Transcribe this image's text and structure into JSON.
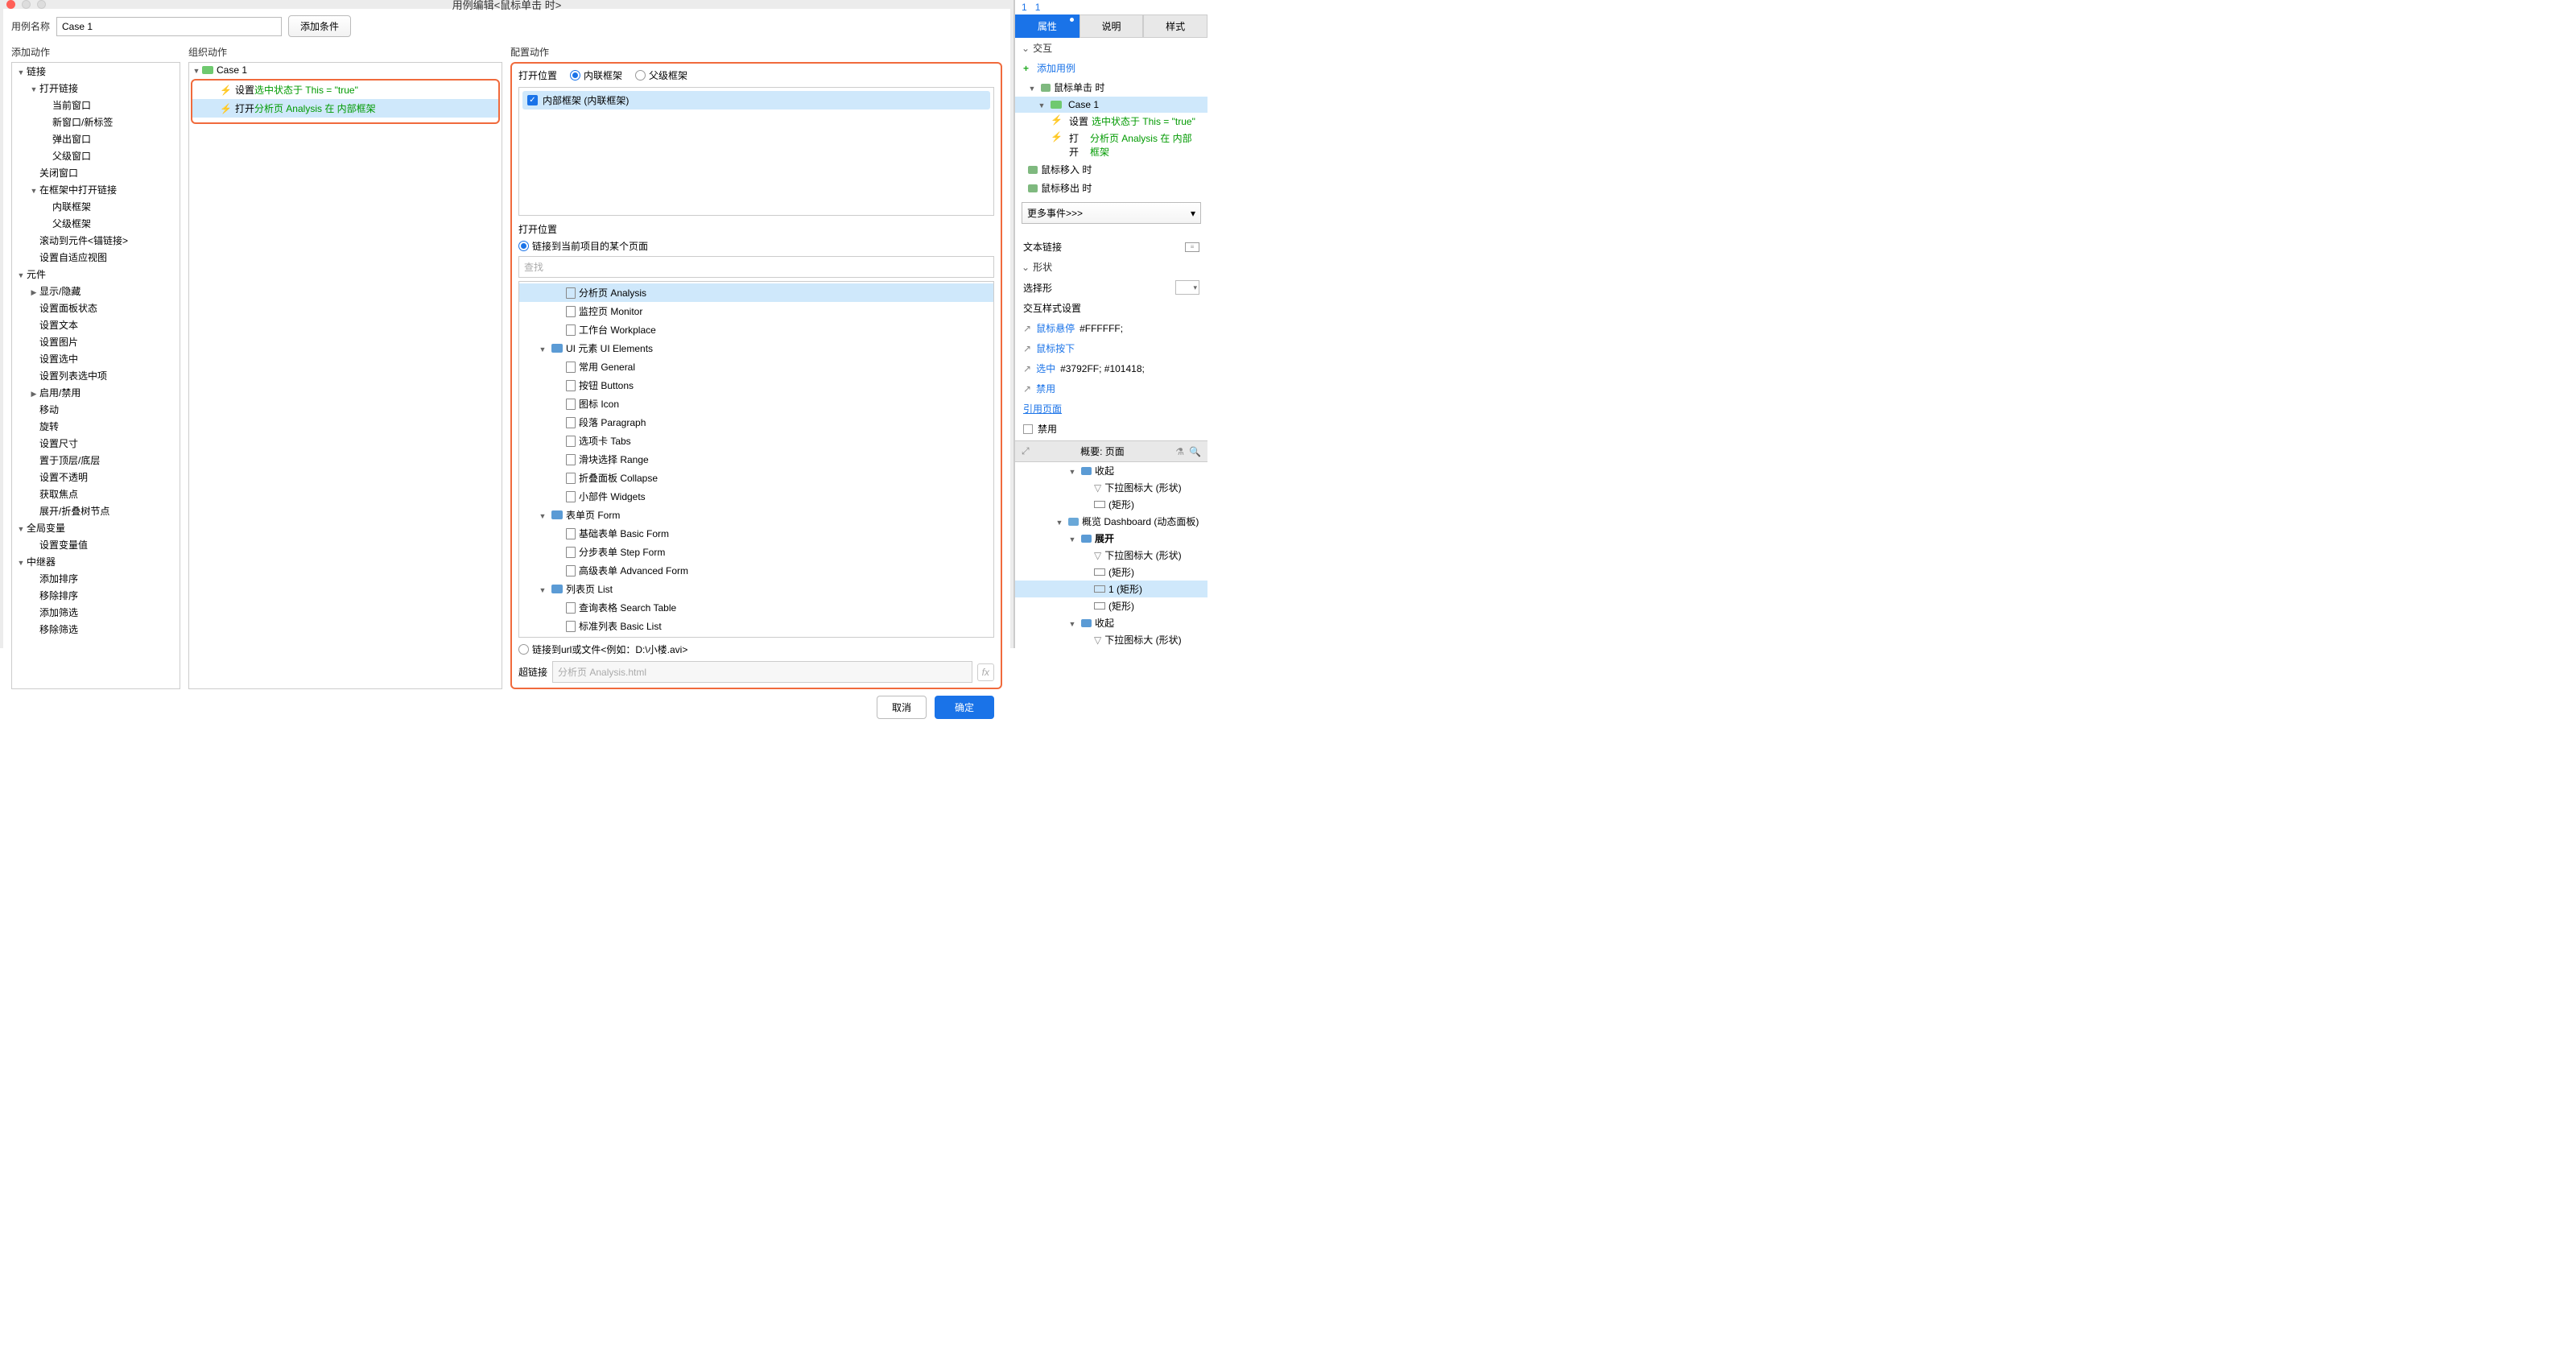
{
  "titlebar": "用例编辑<鼠标单击 时>",
  "caseNameLabel": "用例名称",
  "caseName": "Case 1",
  "addCondition": "添加条件",
  "headers": {
    "add": "添加动作",
    "org": "组织动作",
    "cfg": "配置动作"
  },
  "addTree": [
    {
      "t": "链接",
      "exp": true,
      "lvl": 0
    },
    {
      "t": "打开链接",
      "exp": true,
      "lvl": 1
    },
    {
      "t": "当前窗口",
      "lvl": 2
    },
    {
      "t": "新窗口/新标签",
      "lvl": 2
    },
    {
      "t": "弹出窗口",
      "lvl": 2
    },
    {
      "t": "父级窗口",
      "lvl": 2
    },
    {
      "t": "关闭窗口",
      "lvl": 1
    },
    {
      "t": "在框架中打开链接",
      "exp": true,
      "lvl": 1
    },
    {
      "t": "内联框架",
      "lvl": 2
    },
    {
      "t": "父级框架",
      "lvl": 2
    },
    {
      "t": "滚动到元件<锚链接>",
      "lvl": 1
    },
    {
      "t": "设置自适应视图",
      "lvl": 1
    },
    {
      "t": "元件",
      "exp": true,
      "lvl": 0
    },
    {
      "t": "显示/隐藏",
      "exp": false,
      "lvl": 1
    },
    {
      "t": "设置面板状态",
      "lvl": 1
    },
    {
      "t": "设置文本",
      "lvl": 1
    },
    {
      "t": "设置图片",
      "lvl": 1
    },
    {
      "t": "设置选中",
      "lvl": 1
    },
    {
      "t": "设置列表选中项",
      "lvl": 1
    },
    {
      "t": "启用/禁用",
      "exp": false,
      "lvl": 1
    },
    {
      "t": "移动",
      "lvl": 1
    },
    {
      "t": "旋转",
      "lvl": 1
    },
    {
      "t": "设置尺寸",
      "lvl": 1
    },
    {
      "t": "置于顶层/底层",
      "lvl": 1
    },
    {
      "t": "设置不透明",
      "lvl": 1
    },
    {
      "t": "获取焦点",
      "lvl": 1
    },
    {
      "t": "展开/折叠树节点",
      "lvl": 1
    },
    {
      "t": "全局变量",
      "exp": true,
      "lvl": 0
    },
    {
      "t": "设置变量值",
      "lvl": 1
    },
    {
      "t": "中继器",
      "exp": true,
      "lvl": 0
    },
    {
      "t": "添加排序",
      "lvl": 1
    },
    {
      "t": "移除排序",
      "lvl": 1
    },
    {
      "t": "添加筛选",
      "lvl": 1
    },
    {
      "t": "移除筛选",
      "lvl": 1
    }
  ],
  "orgCaseName": "Case 1",
  "orgActions": [
    {
      "verb": "设置",
      "rest": "选中状态于 This = \"true\""
    },
    {
      "verb": "打开",
      "rest": "分析页 Analysis 在 内部框架",
      "selected": true
    }
  ],
  "cfg": {
    "openAtLabel": "打开位置",
    "radios": [
      "内联框架",
      "父级框架"
    ],
    "checkItem": "内部框架 (内联框架)",
    "openAtLabel2": "打开位置",
    "linkCurrent": "链接到当前项目的某个页面",
    "searchPlaceholder": "查找",
    "pageTree": [
      {
        "t": "分析页 Analysis",
        "icon": "page",
        "lvl": 2,
        "sel": true
      },
      {
        "t": "监控页 Monitor",
        "icon": "page",
        "lvl": 2
      },
      {
        "t": "工作台 Workplace",
        "icon": "page",
        "lvl": 2
      },
      {
        "t": "UI 元素 UI Elements",
        "icon": "folder",
        "lvl": 1,
        "exp": true
      },
      {
        "t": "常用 General",
        "icon": "page",
        "lvl": 2
      },
      {
        "t": "按钮 Buttons",
        "icon": "page",
        "lvl": 2
      },
      {
        "t": "图标 Icon",
        "icon": "page",
        "lvl": 2
      },
      {
        "t": "段落 Paragraph",
        "icon": "page",
        "lvl": 2
      },
      {
        "t": "选项卡 Tabs",
        "icon": "page",
        "lvl": 2
      },
      {
        "t": "滑块选择 Range",
        "icon": "page",
        "lvl": 2
      },
      {
        "t": "折叠面板 Collapse",
        "icon": "page",
        "lvl": 2
      },
      {
        "t": "小部件 Widgets",
        "icon": "page",
        "lvl": 2
      },
      {
        "t": "表单页 Form",
        "icon": "folder",
        "lvl": 1,
        "exp": true
      },
      {
        "t": "基础表单 Basic Form",
        "icon": "page",
        "lvl": 2
      },
      {
        "t": "分步表单 Step Form",
        "icon": "page",
        "lvl": 2
      },
      {
        "t": "高级表单 Advanced Form",
        "icon": "page",
        "lvl": 2
      },
      {
        "t": "列表页 List",
        "icon": "folder",
        "lvl": 1,
        "exp": true
      },
      {
        "t": "查询表格 Search Table",
        "icon": "page",
        "lvl": 2
      },
      {
        "t": "标准列表 Basic List",
        "icon": "page",
        "lvl": 2
      }
    ],
    "linkUrl": "链接到url或文件<例如：D:\\小楼.avi>",
    "hyperlinkLabel": "超链接",
    "hyperlinkValue": "分析页 Analysis.html"
  },
  "footer": {
    "cancel": "取消",
    "ok": "确定"
  },
  "inspector": {
    "nums": [
      "1",
      "1"
    ],
    "tabs": [
      "属性",
      "说明",
      "样式"
    ],
    "sectionInteract": "交互",
    "addCase": "添加用例",
    "events": [
      {
        "t": "鼠标单击 时",
        "exp": true
      },
      {
        "t": "Case 1",
        "case": true
      },
      {
        "sub": true,
        "verb": "设置",
        "rest": "选中状态于 This = \"true\""
      },
      {
        "sub": true,
        "verb": "打开",
        "rest": "分析页 Analysis 在 内部框架"
      },
      {
        "t": "鼠标移入 时"
      },
      {
        "t": "鼠标移出 时"
      }
    ],
    "moreEvents": "更多事件>>>",
    "textLink": "文本链接",
    "shape": "形状",
    "selectShape": "选择形",
    "interactStyle": "交互样式设置",
    "styleRows": [
      {
        "label": "鼠标悬停",
        "val": "#FFFFFF;",
        "link": true
      },
      {
        "label": "鼠标按下",
        "link": true
      },
      {
        "label": "选中",
        "val": "#3792FF; #101418;",
        "link": true
      },
      {
        "label": "禁用",
        "link": true
      }
    ],
    "refPage": "引用页面",
    "disable": "禁用",
    "outlineTitle": "概要: 页面",
    "outline": [
      {
        "t": "收起",
        "icon": "folder",
        "lvl": 1,
        "exp": true
      },
      {
        "t": "下拉图标大 (形状)",
        "icon": "tri",
        "lvl": 2
      },
      {
        "t": "(矩形)",
        "icon": "rect",
        "lvl": 2
      },
      {
        "t": "概览 Dashboard (动态面板)",
        "icon": "panel",
        "lvl": 0,
        "exp": true
      },
      {
        "t": "展开",
        "icon": "folder",
        "lvl": 1,
        "exp": true,
        "bold": true
      },
      {
        "t": "下拉图标大 (形状)",
        "icon": "tri",
        "lvl": 2
      },
      {
        "t": "(矩形)",
        "icon": "rect",
        "lvl": 2
      },
      {
        "t": "1 (矩形)",
        "icon": "rect",
        "lvl": 2,
        "sel": true
      },
      {
        "t": "(矩形)",
        "icon": "rect",
        "lvl": 2
      },
      {
        "t": "收起",
        "icon": "folder",
        "lvl": 1,
        "exp": true
      },
      {
        "t": "下拉图标大 (形状)",
        "icon": "tri",
        "lvl": 2
      }
    ]
  }
}
